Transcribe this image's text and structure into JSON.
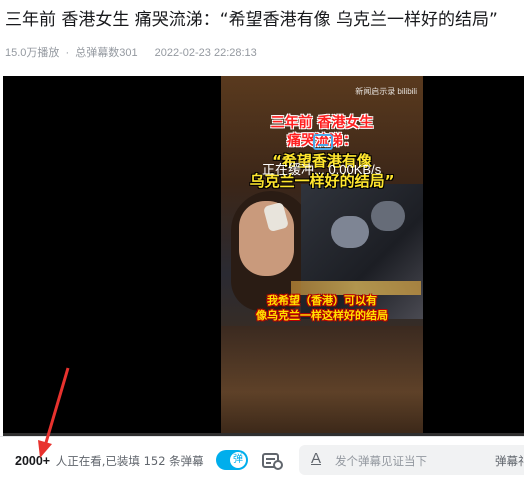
{
  "video": {
    "title": "三年前 香港女生 痛哭流涕：“希望香港有像 乌克兰一样好的结局”",
    "plays": "15.0万播放",
    "separator": "·",
    "danmaku_total": "总弹幕数301",
    "date": "2022-02-23 22:28:13"
  },
  "player": {
    "watermark": "新闻启示录 bilibili",
    "caption_line1": "三年前 香港女生",
    "caption_line2": "痛哭流涕：",
    "caption_line3": "“希望香港有像",
    "caption_line4": "乌克兰一样好的结局”",
    "subtitle_line1": "我希望（香港）可以有",
    "subtitle_line2": "像乌克兰一样这样好的结局",
    "buffering": "正在缓冲... 0.00KB/s",
    "progress": 0.0
  },
  "control_bar": {
    "viewer_count": "2000+",
    "viewer_text": "人正在看,已装填 152 条弹幕",
    "danmaku_toggle_label": "弹",
    "danmaku_input_placeholder": "发个弹幕见证当下",
    "danmaku_etiquette": "弹幕礼"
  },
  "colors": {
    "accent": "#00aeec",
    "annotation_arrow": "#e8322e",
    "caption_red": "#ff2020",
    "caption_yellow": "#ffe62e"
  }
}
